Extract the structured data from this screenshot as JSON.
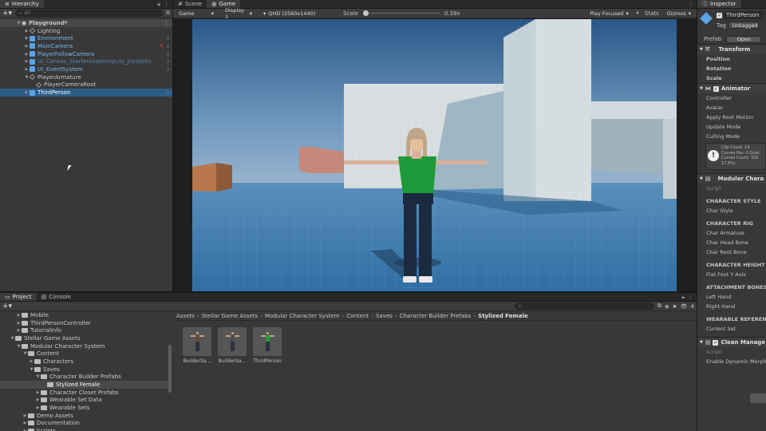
{
  "hierarchy": {
    "tab": "Hierarchy",
    "search_placeholder": "All",
    "scene": "Playground*",
    "items": [
      {
        "label": "Lighting",
        "type": "go",
        "style": "normal"
      },
      {
        "label": "Environment",
        "type": "prefab",
        "style": "blue"
      },
      {
        "label": "MainCamera",
        "type": "prefab",
        "style": "blue"
      },
      {
        "label": "PlayerFollowCamera",
        "type": "prefab",
        "style": "blue"
      },
      {
        "label": "UI_Canvas_StarterAssetsInputs_Joysticks",
        "type": "prefab",
        "style": "dim"
      },
      {
        "label": "UI_EventSystem",
        "type": "prefab",
        "style": "blue"
      },
      {
        "label": "PlayerArmature",
        "type": "go",
        "style": "normal"
      },
      {
        "label": "PlayerCameraRoot",
        "type": "go",
        "style": "normal"
      },
      {
        "label": "ThirdPerson",
        "type": "prefab",
        "style": "selected"
      }
    ]
  },
  "scene_tabs": {
    "scene": "Scene",
    "game": "Game"
  },
  "game_toolbar": {
    "mode": "Game",
    "display": "Display 1",
    "resolution": "QHD (2560x1440)",
    "scale_label": "Scale",
    "scale_value": "0.39x",
    "play_focused": "Play Focused",
    "stats": "Stats",
    "gizmos": "Gizmos"
  },
  "project": {
    "tabs": [
      "Project",
      "Console"
    ],
    "tree": [
      {
        "label": "Mobile",
        "indent": 2
      },
      {
        "label": "ThirdPersonController",
        "indent": 2
      },
      {
        "label": "TutorialInfo",
        "indent": 2
      },
      {
        "label": "Stellar Game Assets",
        "indent": 1
      },
      {
        "label": "Modular Character System",
        "indent": 2
      },
      {
        "label": "Content",
        "indent": 3
      },
      {
        "label": "Characters",
        "indent": 4
      },
      {
        "label": "Saves",
        "indent": 4
      },
      {
        "label": "Character Builder Prefabs",
        "indent": 5
      },
      {
        "label": "Stylized Female",
        "indent": 6,
        "selected": true
      },
      {
        "label": "Character Closet Prefabs",
        "indent": 5
      },
      {
        "label": "Wearable Set Data",
        "indent": 5
      },
      {
        "label": "Wearable Sets",
        "indent": 5
      },
      {
        "label": "Demo Assets",
        "indent": 3
      },
      {
        "label": "Documentation",
        "indent": 3
      },
      {
        "label": "Scripts",
        "indent": 3
      }
    ],
    "breadcrumb": [
      "Assets",
      "Stellar Game Assets",
      "Modular Character System",
      "Content",
      "Saves",
      "Character Builder Prefabs",
      "Stylized Female"
    ],
    "assets": [
      {
        "label": "BuilderSa..."
      },
      {
        "label": "BuilderSa..."
      },
      {
        "label": "ThirdPerson"
      }
    ],
    "count": "4"
  },
  "inspector": {
    "tab": "Inspector",
    "object_name": "ThirdPerson",
    "tag_label": "Tag",
    "tag_value": "Untagged",
    "prefab_label": "Prefab",
    "prefab_open": "Open",
    "transform": {
      "title": "Transform",
      "rows": [
        "Position",
        "Rotation",
        "Scale"
      ]
    },
    "animator": {
      "title": "Animator",
      "rows": [
        "Controller",
        "Avatar",
        "Apply Root Motion",
        "Update Mode",
        "Culling Mode"
      ],
      "info": [
        "Clip Count: 14",
        "Curves Pos: 0 Quat",
        "Curves Count: 102",
        "17.8%)"
      ]
    },
    "modular": {
      "title": "Modular Chara",
      "script": "Script",
      "groups": [
        {
          "head": "CHARACTER STYLE",
          "rows": [
            "Char Style"
          ]
        },
        {
          "head": "CHARACTER RIG",
          "rows": [
            "Char Armature",
            "Char Head Bone",
            "Char Root Bone"
          ]
        },
        {
          "head": "CHARACTER HEIGHT",
          "rows": [
            "Flat Foot Y Axis"
          ]
        },
        {
          "head": "ATTACHMENT BONES",
          "rows": [
            "Left Hand",
            "Right Hand"
          ]
        },
        {
          "head": "WEARABLE REFEREN",
          "rows": [
            "Current Set"
          ]
        }
      ]
    },
    "clean": {
      "title": "Clean Manage",
      "script": "Script",
      "rows": [
        "Enable Dynamic Morph"
      ]
    }
  },
  "colors": {
    "selection": "#2c5d87",
    "prefab_blue": "#74b4ef",
    "sky_top": "#2a5a8c",
    "floor": "#3c7cad"
  }
}
